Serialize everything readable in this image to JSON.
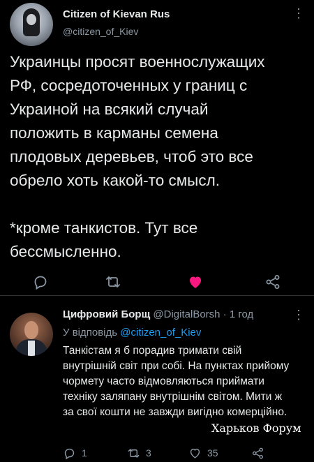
{
  "tweet": {
    "author_name": "Citizen of Kievan Rus",
    "author_handle": "@citizen_of_Kiev",
    "text": "Украинцы просят военнослужащих\nРФ, сосредоточенных у границ с\nУкраиной на всякий случай\nположить в карманы семена\nплодовых деревьев, чтоб это все\nобрело хоть какой-то смысл.\n\n*кроме танкистов. Тут все\nбессмысленно.",
    "actions": {
      "reply_icon": "comment-icon",
      "retweet_icon": "retweet-icon",
      "like_icon": "heart-icon-filled",
      "share_icon": "share-icon"
    },
    "like_color": "#f91880"
  },
  "reply": {
    "author_name": "Цифровий Борщ",
    "author_handle": "@DigitalBorsh",
    "separator": "·",
    "time": "1 год",
    "reply_to_prefix": "У відповідь",
    "reply_to_mention": "@citizen_of_Kiev",
    "text": "Танкістам я б порадив тримати свій внутрішній світ при собі. На пунктах прийому чормету часто відмовляються приймати техніку заляпану внутрішнім світом. Мити ж за свої кошти не завжди вигідно комерційно.",
    "replies_count": "1",
    "retweets_count": "3",
    "likes_count": "35",
    "mention_color": "#1d9bf0"
  },
  "watermark": "Харьков Форум"
}
